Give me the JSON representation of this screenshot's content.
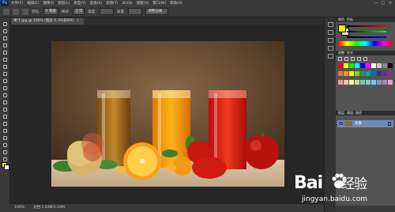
{
  "menubar": {
    "logo": "Ps",
    "items": [
      "文件(F)",
      "编辑(E)",
      "图像(I)",
      "图层(L)",
      "类型(Y)",
      "选择(S)",
      "滤镜(T)",
      "3D(D)",
      "视图(V)",
      "窗口(W)",
      "帮助(H)"
    ],
    "minimize": "—",
    "maximize": "□",
    "close": "×"
  },
  "options": {
    "feather_label": "羽化:",
    "feather_value": "0 像素",
    "style_label": "样式:",
    "style_value": "正常",
    "width_label": "宽度:",
    "height_label": "高度:",
    "refine_edge": "调整边缘..."
  },
  "document": {
    "tab_title": "果汁.jpg @ 100% (图层 0, RGB/8#)",
    "tab_close": "×"
  },
  "status": {
    "zoom": "100%",
    "doc_info": "文档:1.03M/1.03M"
  },
  "panels": {
    "color_tab": "颜色",
    "swatches_tab": "色板",
    "adjustments_tab": "调整",
    "styles_tab": "样式",
    "layers_tab": "图层",
    "channels_tab": "通道",
    "paths_tab": "路径",
    "layer_name": "背景",
    "swatch_colors": [
      "#ff0000",
      "#ffff00",
      "#00ff00",
      "#00ffff",
      "#0000ff",
      "#ff00ff",
      "#ffffff",
      "#cccccc",
      "#888888",
      "#000000",
      "#f26c4f",
      "#f7941d",
      "#fff200",
      "#8dc63f",
      "#00a651",
      "#00a99d",
      "#0072bc",
      "#2e3192",
      "#662d91",
      "#92278f",
      "#f5989d",
      "#fdc68a",
      "#fff799",
      "#c4df9b",
      "#82ca9c",
      "#7accc8",
      "#6dcff6",
      "#8393ca",
      "#a187be",
      "#f49ac2"
    ],
    "fg_color": "#f3e800",
    "bg_color": "#ffffff"
  },
  "watermark": {
    "logo_left": "Bai",
    "logo_right": "经验",
    "url": "jingyan.baidu.com"
  }
}
